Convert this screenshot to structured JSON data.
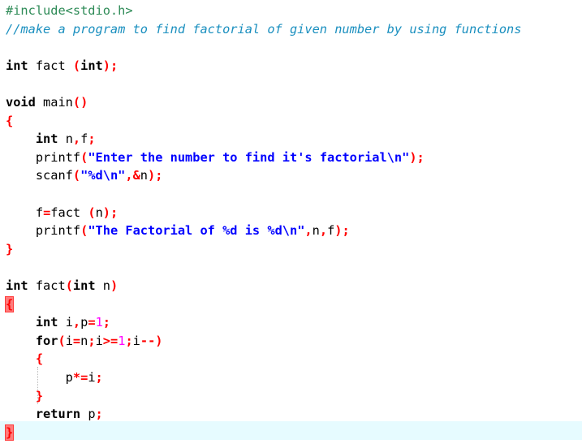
{
  "editor": {
    "current_line_bg": "#e6fbff",
    "lines": [
      [
        {
          "t": "pp",
          "v": "#include<stdio.h>"
        }
      ],
      [
        {
          "t": "cm",
          "v": "//make a program to find factorial of given number by using functions"
        }
      ],
      [],
      [
        {
          "t": "kw",
          "v": "int"
        },
        {
          "t": "id",
          "v": " fact "
        },
        {
          "t": "op",
          "v": "("
        },
        {
          "t": "kw",
          "v": "int"
        },
        {
          "t": "op",
          "v": ");"
        }
      ],
      [],
      [
        {
          "t": "kw",
          "v": "void"
        },
        {
          "t": "id",
          "v": " main"
        },
        {
          "t": "op",
          "v": "()"
        }
      ],
      [
        {
          "t": "op",
          "v": "{"
        }
      ],
      [
        {
          "t": "id",
          "v": "    "
        },
        {
          "t": "kw",
          "v": "int"
        },
        {
          "t": "id",
          "v": " n"
        },
        {
          "t": "op",
          "v": ","
        },
        {
          "t": "id",
          "v": "f"
        },
        {
          "t": "op",
          "v": ";"
        }
      ],
      [
        {
          "t": "id",
          "v": "    printf"
        },
        {
          "t": "op",
          "v": "("
        },
        {
          "t": "st",
          "v": "\"Enter the number to find it's factorial\\n\""
        },
        {
          "t": "op",
          "v": ");"
        }
      ],
      [
        {
          "t": "id",
          "v": "    scanf"
        },
        {
          "t": "op",
          "v": "("
        },
        {
          "t": "st",
          "v": "\"%d\\n\""
        },
        {
          "t": "op",
          "v": ",&"
        },
        {
          "t": "id",
          "v": "n"
        },
        {
          "t": "op",
          "v": ");"
        }
      ],
      [],
      [
        {
          "t": "id",
          "v": "    f"
        },
        {
          "t": "op",
          "v": "="
        },
        {
          "t": "id",
          "v": "fact "
        },
        {
          "t": "op",
          "v": "("
        },
        {
          "t": "id",
          "v": "n"
        },
        {
          "t": "op",
          "v": ");"
        }
      ],
      [
        {
          "t": "id",
          "v": "    printf"
        },
        {
          "t": "op",
          "v": "("
        },
        {
          "t": "st",
          "v": "\"The Factorial of %d is %d\\n\""
        },
        {
          "t": "op",
          "v": ","
        },
        {
          "t": "id",
          "v": "n"
        },
        {
          "t": "op",
          "v": ","
        },
        {
          "t": "id",
          "v": "f"
        },
        {
          "t": "op",
          "v": ");"
        }
      ],
      [
        {
          "t": "op",
          "v": "}"
        }
      ],
      [],
      [
        {
          "t": "kw",
          "v": "int"
        },
        {
          "t": "id",
          "v": " fact"
        },
        {
          "t": "op",
          "v": "("
        },
        {
          "t": "kw",
          "v": "int"
        },
        {
          "t": "id",
          "v": " n"
        },
        {
          "t": "op",
          "v": ")"
        }
      ],
      [
        {
          "t": "op",
          "v": "{",
          "box": true
        }
      ],
      [
        {
          "t": "id",
          "v": "    "
        },
        {
          "t": "kw",
          "v": "int"
        },
        {
          "t": "id",
          "v": " i"
        },
        {
          "t": "op",
          "v": ","
        },
        {
          "t": "id",
          "v": "p"
        },
        {
          "t": "op",
          "v": "="
        },
        {
          "t": "nm",
          "v": "1"
        },
        {
          "t": "op",
          "v": ";"
        }
      ],
      [
        {
          "t": "id",
          "v": "    "
        },
        {
          "t": "kw",
          "v": "for"
        },
        {
          "t": "op",
          "v": "("
        },
        {
          "t": "id",
          "v": "i"
        },
        {
          "t": "op",
          "v": "="
        },
        {
          "t": "id",
          "v": "n"
        },
        {
          "t": "op",
          "v": ";"
        },
        {
          "t": "id",
          "v": "i"
        },
        {
          "t": "op",
          "v": ">="
        },
        {
          "t": "nm",
          "v": "1"
        },
        {
          "t": "op",
          "v": ";"
        },
        {
          "t": "id",
          "v": "i"
        },
        {
          "t": "op",
          "v": "--)"
        }
      ],
      [
        {
          "t": "id",
          "v": "    "
        },
        {
          "t": "op",
          "v": "{"
        }
      ],
      [
        {
          "t": "id",
          "v": "        p"
        },
        {
          "t": "op",
          "v": "*="
        },
        {
          "t": "id",
          "v": "i"
        },
        {
          "t": "op",
          "v": ";"
        }
      ],
      [
        {
          "t": "id",
          "v": "    "
        },
        {
          "t": "op",
          "v": "}"
        }
      ],
      [
        {
          "t": "id",
          "v": "    "
        },
        {
          "t": "kw",
          "v": "return"
        },
        {
          "t": "id",
          "v": " p"
        },
        {
          "t": "op",
          "v": ";"
        }
      ],
      [
        {
          "t": "op",
          "v": "}",
          "box": true
        }
      ]
    ]
  }
}
